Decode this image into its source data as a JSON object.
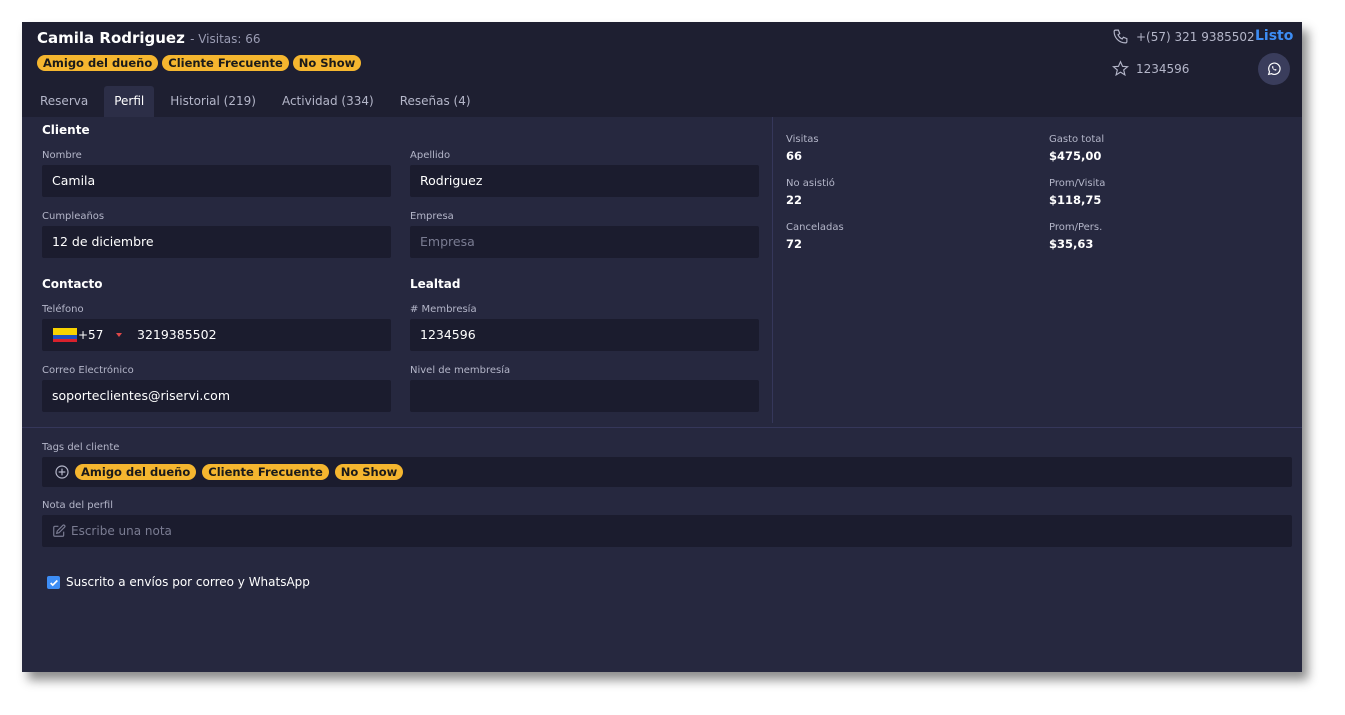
{
  "customer": {
    "name": "Camila Rodriguez",
    "visits_text": "- Visitas: 66",
    "tags": [
      "Amigo del dueño",
      "Cliente Frecuente",
      "No Show"
    ],
    "phone_display": "+(57) 321 9385502",
    "membership_display": "1234596"
  },
  "header": {
    "done_label": "Listo",
    "icons": {
      "phone": "phone-icon",
      "star": "star-icon",
      "whatsapp": "whatsapp-icon"
    }
  },
  "tabs": [
    {
      "label": "Reserva",
      "active": false
    },
    {
      "label": "Perfil",
      "active": true
    },
    {
      "label": "Historial (219)",
      "active": false
    },
    {
      "label": "Actividad (334)",
      "active": false
    },
    {
      "label": "Reseñas (4)",
      "active": false
    }
  ],
  "profile": {
    "client_section": "Cliente",
    "first_name_label": "Nombre",
    "first_name": "Camila",
    "last_name_label": "Apellido",
    "last_name": "Rodriguez",
    "birthday_label": "Cumpleaños",
    "birthday": "12 de diciembre",
    "company_label": "Empresa",
    "company_placeholder": "Empresa",
    "contact_section": "Contacto",
    "phone_label": "Teléfono",
    "country_code": "+57",
    "phone": "3219385502",
    "email_label": "Correo Electrónico",
    "email": "soporteclientes@riservi.com",
    "loyalty_section": "Lealtad",
    "membership_label": "# Membresía",
    "membership": "1234596",
    "level_label": "Nivel de membresía",
    "level": ""
  },
  "stats": {
    "visits_label": "Visitas",
    "visits": "66",
    "noshow_label": "No asistió",
    "noshow": "22",
    "cancelled_label": "Canceladas",
    "cancelled": "72",
    "total_spend_label": "Gasto total",
    "total_spend": "$475,00",
    "avg_visit_label": "Prom/Visita",
    "avg_visit": "$118,75",
    "avg_person_label": "Prom/Pers.",
    "avg_person": "$35,63"
  },
  "bottom": {
    "tags_label": "Tags del cliente",
    "note_label": "Nota del perfil",
    "note_placeholder": "Escribe una nota",
    "subscribe_label": "Suscrito a envíos por correo y WhatsApp",
    "subscribed": true
  },
  "colors": {
    "background": "#26283f",
    "header": "#1e1f31",
    "field": "#1b1c2e",
    "tag": "#f5b62f",
    "accent": "#3d8df5"
  }
}
